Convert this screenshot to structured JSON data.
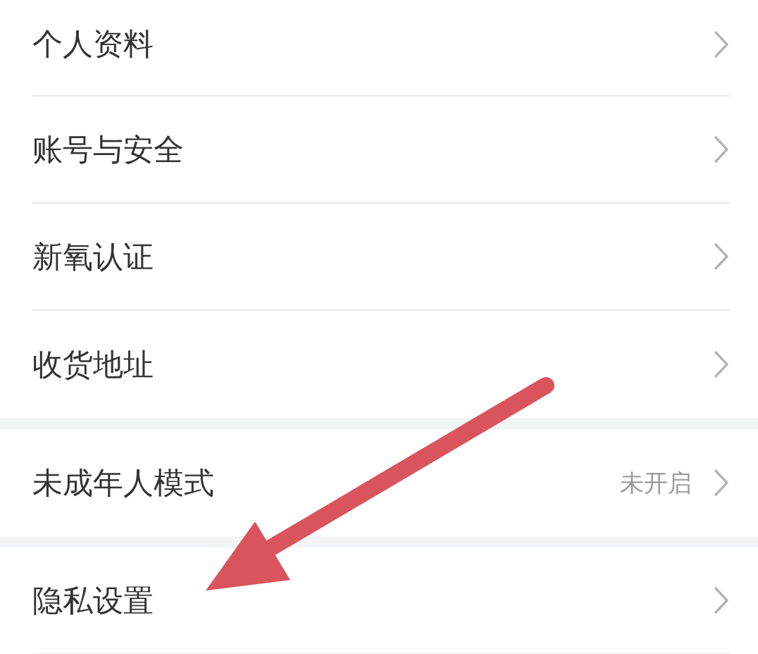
{
  "settings_groups": [
    {
      "items": [
        {
          "label": "个人资料"
        },
        {
          "label": "账号与安全"
        },
        {
          "label": "新氧认证"
        },
        {
          "label": "收货地址"
        }
      ]
    },
    {
      "items": [
        {
          "label": "未成年人模式",
          "value": "未开启"
        }
      ]
    },
    {
      "items": [
        {
          "label": "隐私设置"
        }
      ]
    }
  ]
}
